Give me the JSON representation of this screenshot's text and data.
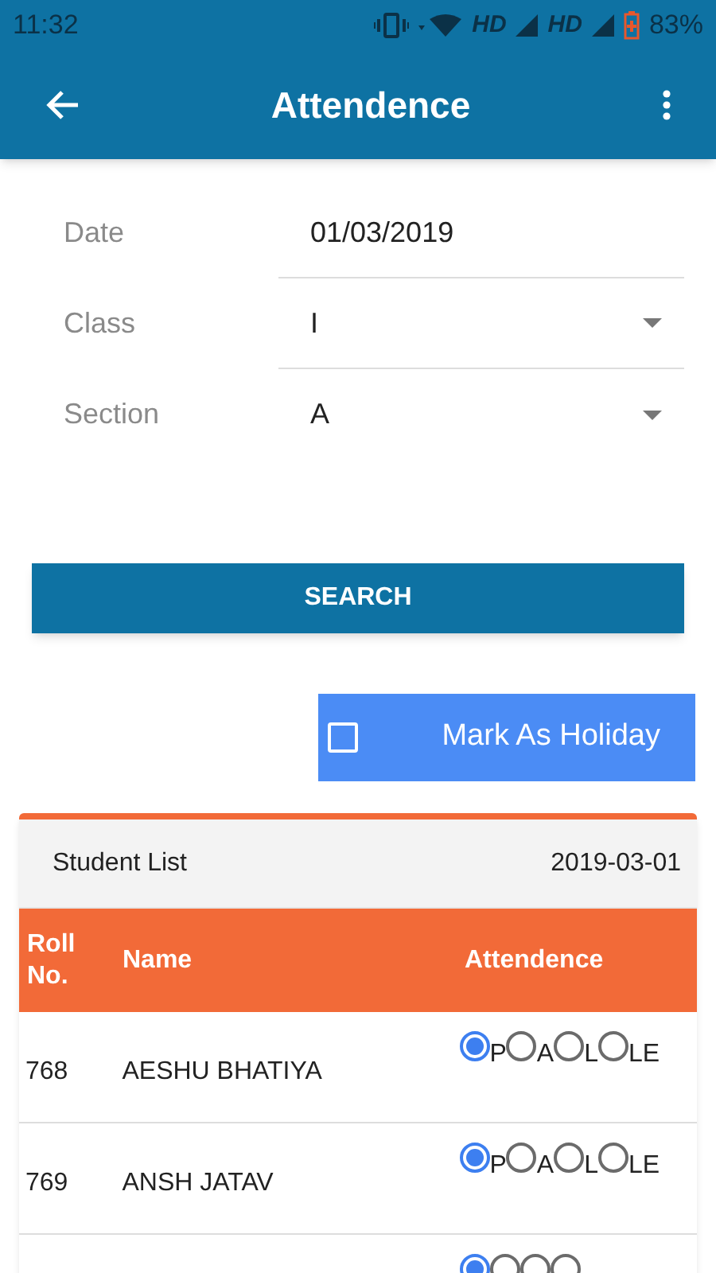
{
  "status_bar": {
    "time": "11:32",
    "network_1": "HD",
    "network_2": "HD",
    "battery": "83%"
  },
  "app_bar": {
    "title": "Attendence"
  },
  "form": [
    {
      "kind": "text",
      "label": "Date",
      "value": "01/03/2019"
    },
    {
      "kind": "dropdown",
      "label": "Class",
      "value": "I"
    },
    {
      "kind": "dropdown",
      "label": "Section",
      "value": "A"
    }
  ],
  "search_button": "SEARCH",
  "holiday": {
    "label": "Mark As Holiday",
    "checked": false
  },
  "student_list": {
    "title": "Student List",
    "date": "2019-03-01",
    "columns": [
      "Roll No.",
      "Name",
      "Attendence"
    ],
    "rows": [
      {
        "roll": "768",
        "name": "AESHU BHATIYA",
        "options": [
          {
            "label": "P",
            "selected": true
          },
          {
            "label": "A",
            "selected": false
          },
          {
            "label": "L",
            "selected": false
          },
          {
            "label": "LE",
            "selected": false
          }
        ]
      },
      {
        "roll": "769",
        "name": "ANSH JATAV",
        "options": [
          {
            "label": "P",
            "selected": true
          },
          {
            "label": "A",
            "selected": false
          },
          {
            "label": "L",
            "selected": false
          },
          {
            "label": "LE",
            "selected": false
          }
        ]
      },
      {
        "options": [
          {
            "selected": true
          },
          {
            "selected": false
          },
          {
            "selected": false
          },
          {
            "selected": false
          }
        ]
      }
    ]
  }
}
